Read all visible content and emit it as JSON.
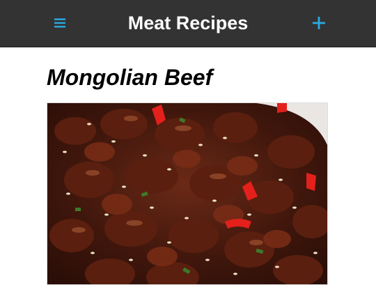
{
  "header": {
    "title": "Meat Recipes",
    "menu_icon": "hamburger-menu-icon",
    "add_icon": "plus-icon"
  },
  "recipe": {
    "title": "Mongolian Beef",
    "image_alt": "Mongolian Beef photo"
  },
  "colors": {
    "header_bg": "#333333",
    "accent": "#29abe2",
    "header_text": "#ffffff",
    "title_text": "#000000"
  }
}
